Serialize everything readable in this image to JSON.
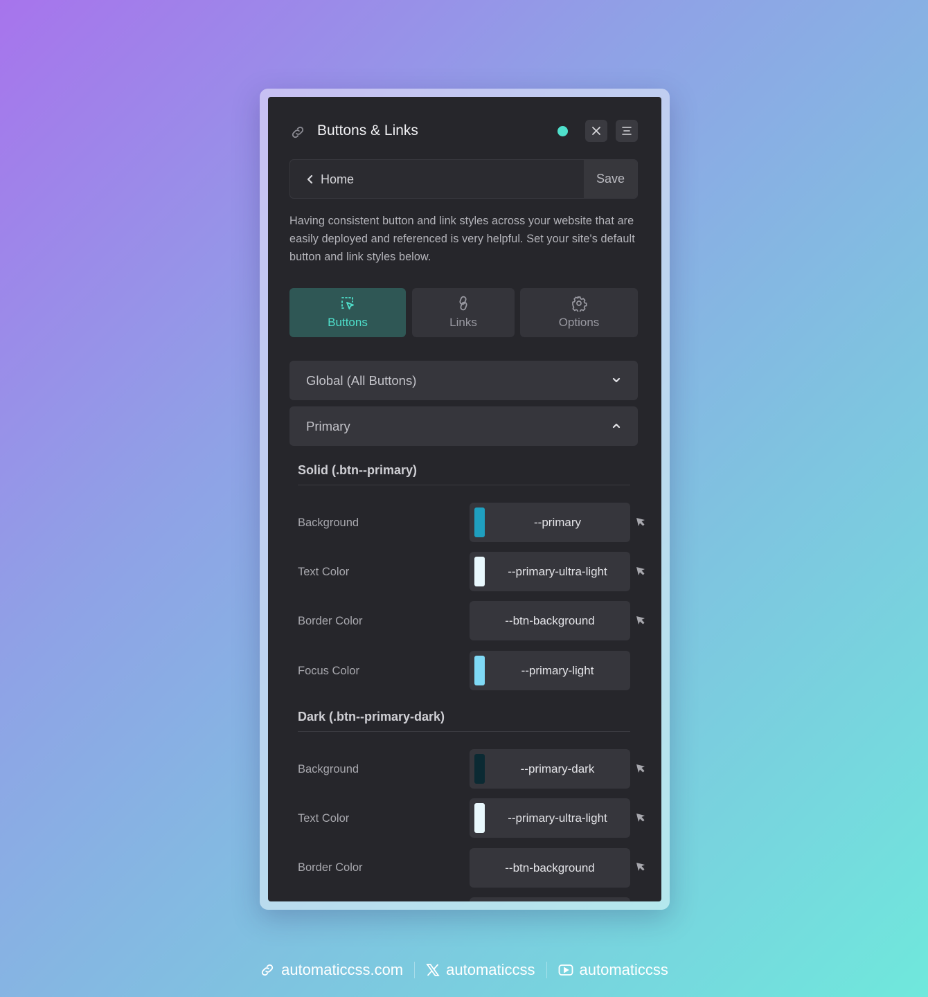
{
  "panel": {
    "title": "Buttons & Links",
    "status_color": "#4fe0cc",
    "breadcrumb": {
      "back_label": "Home",
      "save_label": "Save"
    },
    "description": "Having consistent button and link styles across your website that are easily deployed and referenced is very helpful. Set your site's default button and link styles below.",
    "tabs": [
      {
        "label": "Buttons",
        "icon": "cursor-select-icon",
        "active": true
      },
      {
        "label": "Links",
        "icon": "chain-link-icon",
        "active": false
      },
      {
        "label": "Options",
        "icon": "gear-icon",
        "active": false
      }
    ],
    "accordions": [
      {
        "label": "Global (All Buttons)",
        "expanded": false
      },
      {
        "label": "Primary",
        "expanded": true
      }
    ],
    "sections": [
      {
        "title": "Solid (.btn--primary)",
        "rows": [
          {
            "label": "Background",
            "value": "--primary",
            "swatch": "#1f9fbf"
          },
          {
            "label": "Text Color",
            "value": "--primary-ultra-light",
            "swatch": "#e9f8fd"
          },
          {
            "label": "Border Color",
            "value": "--btn-background",
            "swatch": null
          },
          {
            "label": "Focus Color",
            "value": "--primary-light",
            "swatch": "#7fd9f5"
          }
        ]
      },
      {
        "title": "Dark (.btn--primary-dark)",
        "rows": [
          {
            "label": "Background",
            "value": "--primary-dark",
            "swatch": "#0b2a33"
          },
          {
            "label": "Text Color",
            "value": "--primary-ultra-light",
            "swatch": "#e9f8fd"
          },
          {
            "label": "Border Color",
            "value": "--btn-background",
            "swatch": null
          }
        ]
      }
    ]
  },
  "footer": {
    "links": [
      {
        "label": "automaticcss.com",
        "icon": "chain-link-icon"
      },
      {
        "label": "automaticcss",
        "icon": "x-logo-icon"
      },
      {
        "label": "automaticcss",
        "icon": "youtube-icon"
      }
    ]
  }
}
